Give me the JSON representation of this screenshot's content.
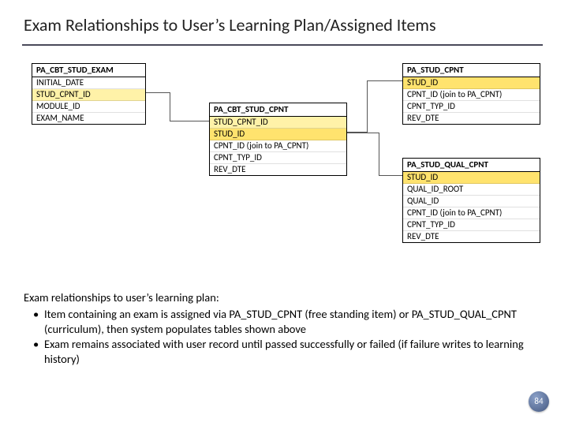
{
  "title": "Exam Relationships to User’s Learning Plan/Assigned Items",
  "entities": {
    "exam": {
      "name": "PA_CBT_STUD_EXAM",
      "rows": [
        {
          "text": "INITIAL_DATE",
          "hl": false
        },
        {
          "text": "STUD_CPNT_ID",
          "hl": true
        },
        {
          "text": "MODULE_ID",
          "hl": false
        },
        {
          "text": "EXAM_NAME",
          "hl": false
        }
      ]
    },
    "cbtcpnt": {
      "name": "PA_CBT_STUD_CPNT",
      "rows": [
        {
          "text": "STUD_CPNT_ID",
          "hl": true
        },
        {
          "text": "STUD_ID",
          "hl": true
        },
        {
          "text": "CPNT_ID  (join to PA_CPNT)",
          "hl": false
        },
        {
          "text": "CPNT_TYP_ID",
          "hl": false
        },
        {
          "text": "REV_DTE",
          "hl": false
        }
      ]
    },
    "studcpnt": {
      "name": "PA_STUD_CPNT",
      "rows": [
        {
          "text": "STUD_ID",
          "hl": true
        },
        {
          "text": "CPNT_ID  (join to PA_CPNT)",
          "hl": false
        },
        {
          "text": "CPNT_TYP_ID",
          "hl": false
        },
        {
          "text": "REV_DTE",
          "hl": false
        }
      ]
    },
    "qualcpnt": {
      "name": "PA_STUD_QUAL_CPNT",
      "rows": [
        {
          "text": "STUD_ID",
          "hl": true
        },
        {
          "text": "QUAL_ID_ROOT",
          "hl": false
        },
        {
          "text": "QUAL_ID",
          "hl": false
        },
        {
          "text": "CPNT_ID  (join to PA_CPNT)",
          "hl": false
        },
        {
          "text": "CPNT_TYP_ID",
          "hl": false
        },
        {
          "text": "REV_DTE",
          "hl": false
        }
      ]
    }
  },
  "notes": {
    "lead": "Exam relationships to user’s learning plan:",
    "bullets": [
      "Item containing an exam is assigned via PA_STUD_CPNT (free standing item) or PA_STUD_QUAL_CPNT (curriculum), then system populates tables shown above",
      "Exam remains associated with user record until passed successfully or failed (if failure writes to learning history)"
    ]
  },
  "pagenum": "84"
}
